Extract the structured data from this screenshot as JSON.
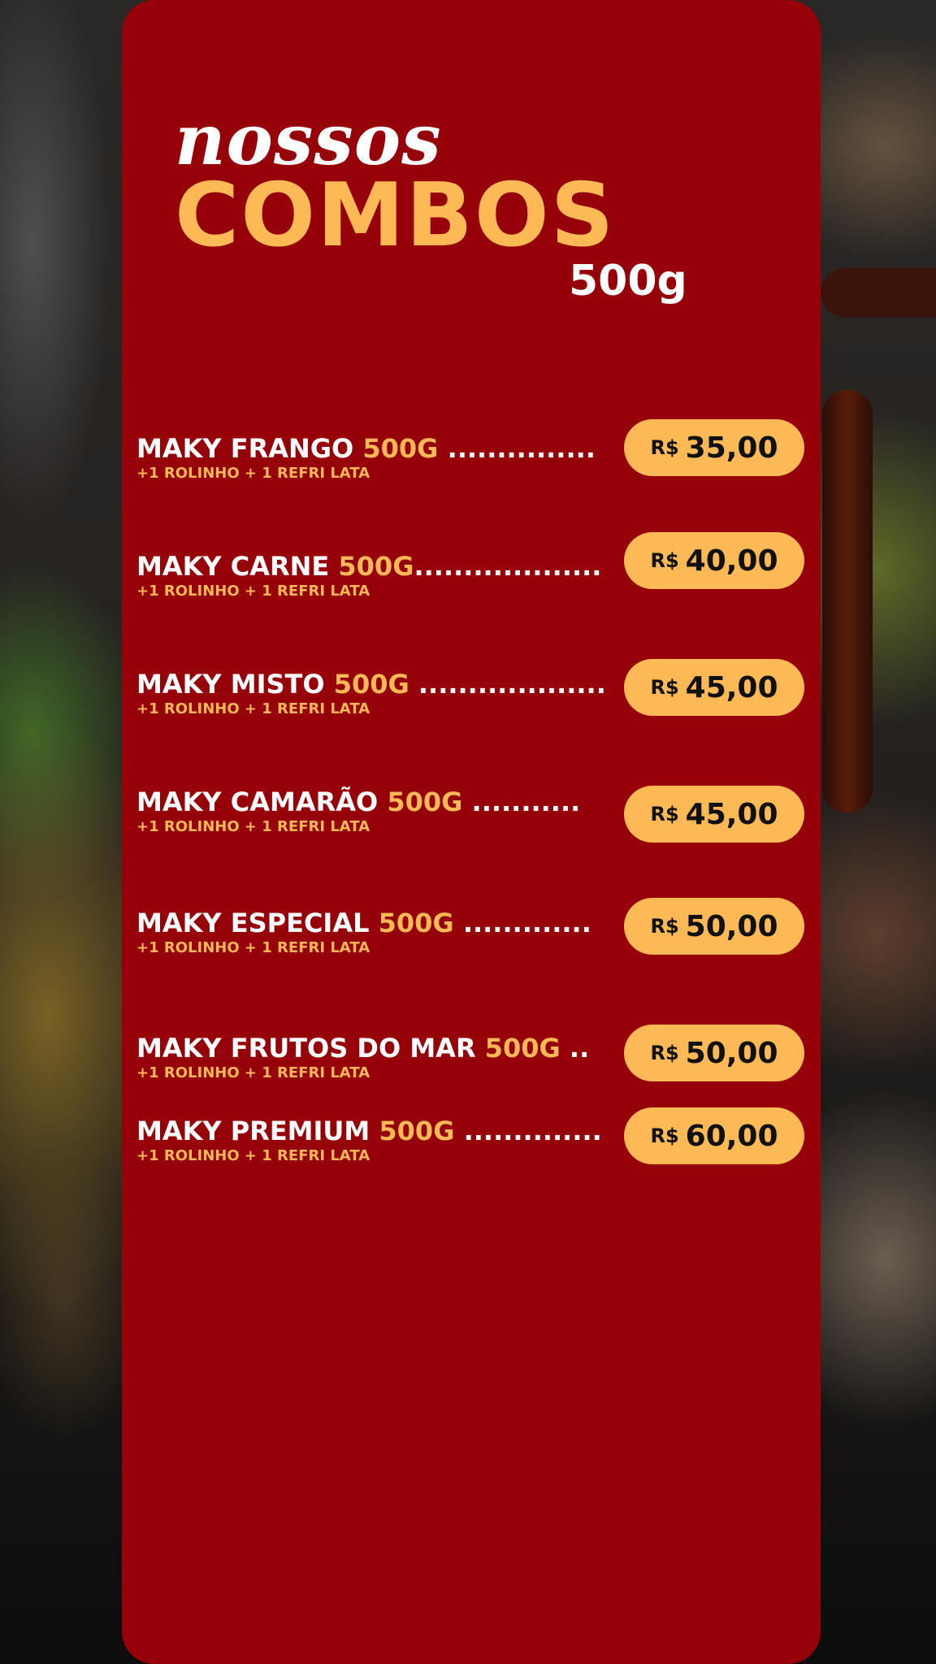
{
  "header": {
    "script_title": "nossos",
    "main_title": "COMBOS",
    "weight": "500g"
  },
  "menu": {
    "currency": "R$",
    "items": [
      {
        "name": "MAKY FRANGO",
        "weight": "500G",
        "dots": " ...............",
        "extras": "+1 ROLINHO + 1 REFRI LATA",
        "price": "35,00"
      },
      {
        "name": "MAKY CARNE",
        "weight": "500G",
        "dots": "...................",
        "extras": "+1 ROLINHO + 1 REFRI LATA",
        "price": "40,00"
      },
      {
        "name": "MAKY MISTO",
        "weight": "500G",
        "dots": " ...................",
        "extras": "+1 ROLINHO + 1 REFRI LATA",
        "price": "45,00"
      },
      {
        "name": "MAKY CAMARÃO",
        "weight": "500G",
        "dots": " ...........",
        "extras": "+1 ROLINHO + 1 REFRI LATA",
        "price": "45,00"
      },
      {
        "name": "MAKY ESPECIAL",
        "weight": "500G",
        "dots": " .............",
        "extras": "+1 ROLINHO + 1 REFRI LATA",
        "price": "50,00"
      },
      {
        "name": "MAKY FRUTOS DO MAR",
        "weight": "500G",
        "dots": " ..",
        "extras": "+1 ROLINHO + 1 REFRI LATA",
        "price": "50,00"
      },
      {
        "name": "MAKY PREMIUM",
        "weight": "500G",
        "dots": " ..............",
        "extras": "+1 ROLINHO + 1 REFRI LATA",
        "price": "60,00"
      }
    ]
  },
  "colors": {
    "panel": "#960008",
    "accent": "#fcb955",
    "text": "#ffffff"
  }
}
